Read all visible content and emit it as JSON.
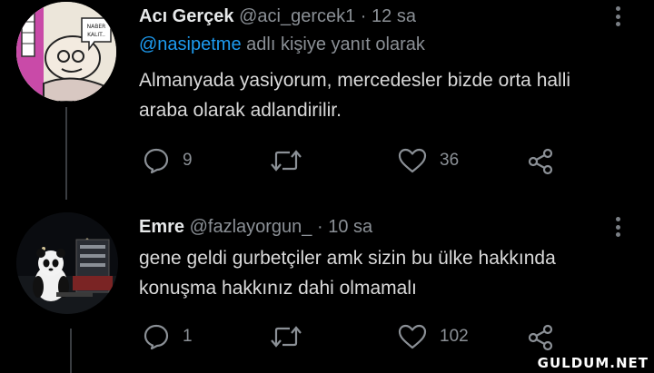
{
  "tweets": [
    {
      "name": "Acı Gerçek",
      "handle": "@aci_gercek1",
      "separator": "·",
      "time": "12 sa",
      "reply_to_mention": "@nasipetme",
      "reply_to_suffix": " adlı kişiye yanıt olarak",
      "text": "Almanyada yasiyorum, mercedesler bizde orta halli\naraba olarak adlandirilir.",
      "avatar_caption": "NABER\nKALIT...",
      "actions": {
        "reply_icon": "comment-bubble-icon",
        "reply_count": "9",
        "retweet_icon": "retweet-icon",
        "like_icon": "heart-icon",
        "like_count": "36",
        "share_icon": "share-icon"
      }
    },
    {
      "name": "Emre",
      "handle": "@fazlayorgun_",
      "separator": "·",
      "time": "10 sa",
      "text": "gene geldi gurbetçiler amk sizin bu ülke hakkında\nkonuşma hakkınız dahi olmamalı",
      "actions": {
        "reply_icon": "comment-bubble-icon",
        "reply_count": "1",
        "retweet_icon": "retweet-icon",
        "like_icon": "heart-icon",
        "like_count": "102",
        "share_icon": "share-icon"
      }
    }
  ],
  "watermark": "GULDUM.NET",
  "colors": {
    "background": "#000000",
    "mention": "#1d9bf0",
    "muted": "#8b9096",
    "text": "#d9d9d9"
  }
}
